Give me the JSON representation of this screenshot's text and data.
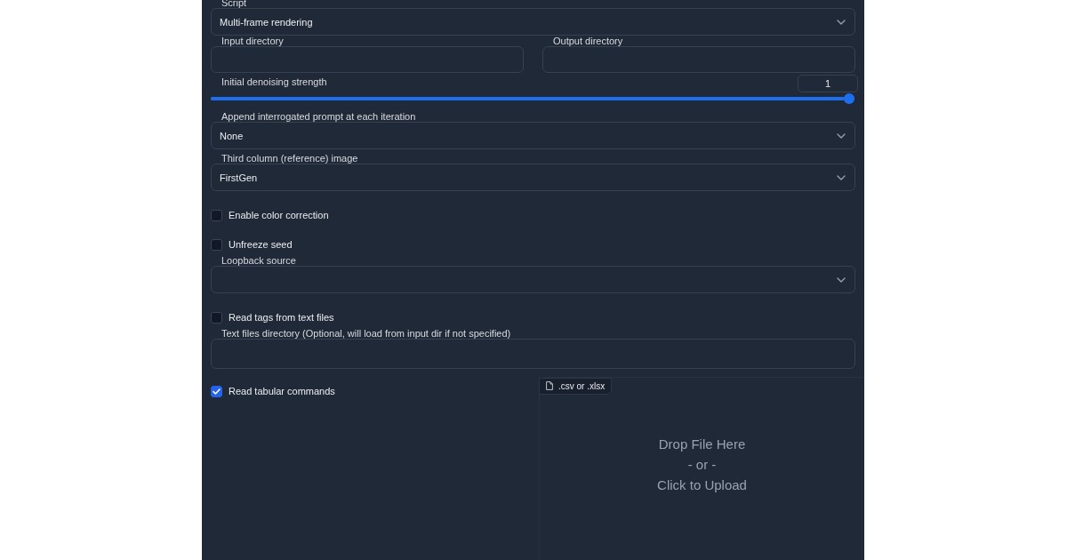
{
  "panel": {
    "fields": [
      {
        "kind": "dropdown",
        "label": "Script",
        "value": "Multi-frame rendering"
      },
      {
        "kind": "textbox_row",
        "fields": [
          {
            "label": "Input directory"
          },
          {
            "label": "Output directory"
          }
        ]
      },
      {
        "kind": "slider",
        "label": "Initial denoising strength",
        "value": "1",
        "level": 1
      },
      {
        "kind": "dropdown",
        "label": "Append interrogated prompt at each iteration",
        "value": "None"
      },
      {
        "kind": "dropdown",
        "label": "Third column (reference) image",
        "value": "FirstGen"
      },
      {
        "kind": "checkbox",
        "label": "Enable color correction",
        "checked": false
      },
      {
        "kind": "checkbox",
        "label": "Unfreeze seed",
        "checked": false
      },
      {
        "kind": "dropdown",
        "label": "Loopback source"
      },
      {
        "kind": "checkbox",
        "label": "Read tags from text files",
        "checked": false
      },
      {
        "kind": "textbox",
        "label": "Text files directory (Optional, will load from input dir if not specified)"
      },
      {
        "kind": "checkbox_file_row",
        "checkbox": {
          "label": "Read tabular commands",
          "checked": true
        },
        "file": {
          "label": ".csv or .xlsx",
          "drop_text": [
            "Drop File Here",
            "- or -",
            "Click to Upload"
          ]
        }
      }
    ]
  }
}
